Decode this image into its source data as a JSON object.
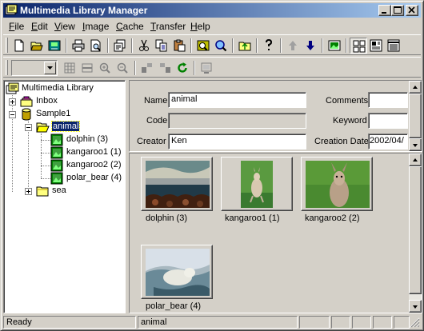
{
  "window": {
    "title": "Multimedia Library Manager"
  },
  "menu": {
    "items": [
      "File",
      "Edit",
      "View",
      "Image",
      "Cache",
      "Transfer",
      "Help"
    ],
    "underline": [
      "F",
      "E",
      "V",
      "I",
      "C",
      "T",
      "H"
    ]
  },
  "toolbar1": {
    "buttons": [
      "new-icon",
      "open-icon",
      "save-library-icon",
      "print-icon",
      "print-preview-icon",
      "properties-icon",
      "cut-icon",
      "copy-icon",
      "paste-icon",
      "find-icon",
      "search-icon",
      "up-folder-icon",
      "help-icon",
      "move-up-icon",
      "move-down-icon",
      "slideshow-icon",
      "large-icons-view-icon",
      "details-view-icon",
      "list-view-icon"
    ]
  },
  "toolbar2": {
    "zoom_value": "",
    "buttons": [
      "grid-icon",
      "fit-icon",
      "zoom-in-icon",
      "zoom-out-icon",
      "rotate-left-icon",
      "rotate-right-icon",
      "refresh-icon",
      "screen-icon"
    ]
  },
  "tree": {
    "root": "Multimedia Library",
    "inbox": "Inbox",
    "library": "Sample1",
    "animal": "animal",
    "children": [
      "dolphin (3)",
      "kangaroo1 (1)",
      "kangaroo2 (2)",
      "polar_bear (4)"
    ],
    "sea": "sea"
  },
  "properties": {
    "name_label": "Name",
    "name_value": "animal",
    "code_label": "Code",
    "code_value": "",
    "creator_label": "Creator",
    "creator_value": "Ken",
    "comments_label": "Comments",
    "comments_value": "",
    "keyword_label": "Keyword",
    "keyword_value": "",
    "creation_date_label": "Creation Date",
    "creation_date_value": "2002/04/"
  },
  "thumbnails": [
    {
      "caption": "dolphin (3)",
      "scene": "dolphin"
    },
    {
      "caption": "kangaroo1 (1)",
      "scene": "kangaroo-standing"
    },
    {
      "caption": "kangaroo2 (2)",
      "scene": "kangaroo-face"
    },
    {
      "caption": "polar_bear (4)",
      "scene": "polar-bear"
    }
  ],
  "status": {
    "left": "Ready",
    "middle": "animal",
    "p3": "",
    "p4": "",
    "p5": "",
    "p6": "",
    "p7": ""
  },
  "colors": {
    "title_start": "#0a246a",
    "title_end": "#a6caf0",
    "face": "#d4d0c8",
    "selection": "#0a246a"
  }
}
